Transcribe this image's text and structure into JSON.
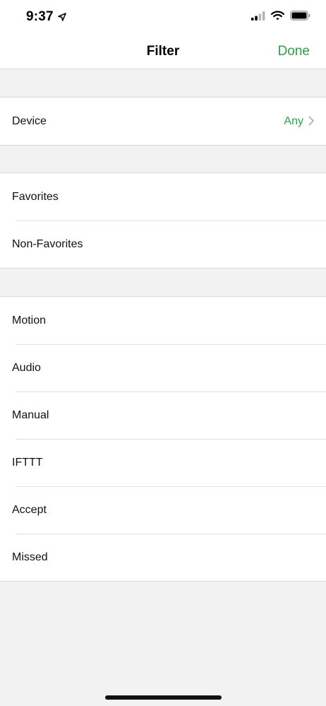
{
  "status_bar": {
    "time": "9:37",
    "location_icon": "location-arrow-icon",
    "signal_icon": "cellular-signal-icon",
    "wifi_icon": "wifi-icon",
    "battery_icon": "battery-icon"
  },
  "nav": {
    "title": "Filter",
    "done_label": "Done"
  },
  "colors": {
    "accent": "#26a640",
    "background": "#f2f2f2"
  },
  "device_section": {
    "label": "Device",
    "value": "Any",
    "chevron_icon": "chevron-right-icon"
  },
  "favorites_section": {
    "items": [
      {
        "label": "Favorites"
      },
      {
        "label": "Non-Favorites"
      }
    ]
  },
  "type_section": {
    "items": [
      {
        "label": "Motion"
      },
      {
        "label": "Audio"
      },
      {
        "label": "Manual"
      },
      {
        "label": "IFTTT"
      },
      {
        "label": "Accept"
      },
      {
        "label": "Missed"
      }
    ]
  }
}
